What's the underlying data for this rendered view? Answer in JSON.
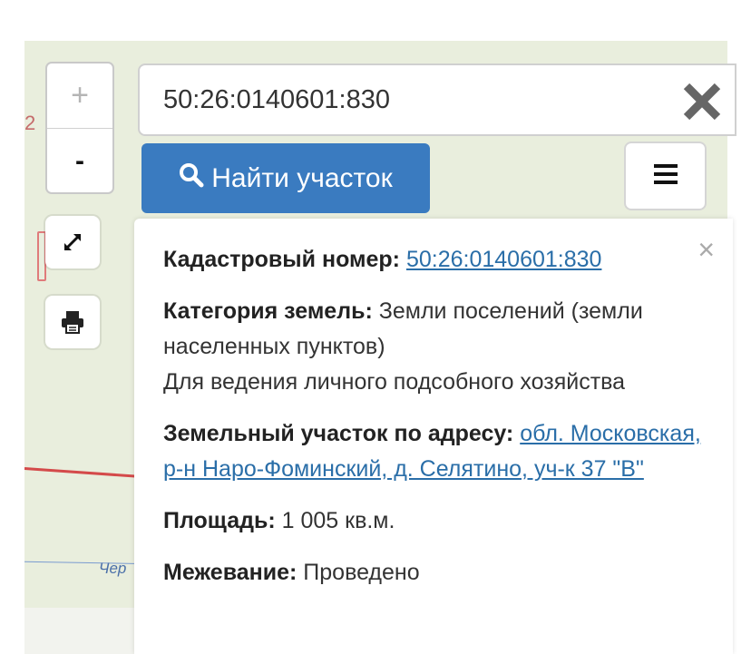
{
  "map": {
    "fragment_number": "2",
    "street_label": "Чер"
  },
  "zoom": {
    "in_label": "+",
    "out_label": "-"
  },
  "search": {
    "value": "50:26:0140601:830",
    "clear_icon": "close-icon"
  },
  "find_button": {
    "label": "Найти участок",
    "icon": "search-icon",
    "color": "#3a7bc0"
  },
  "panel": {
    "close_label": "×",
    "cadastral_label": "Кадастровый номер:",
    "cadastral_value": "50:26:0140601:830",
    "category_label": "Категория земель:",
    "category_value": "Земли поселений (земли населенных пунктов)",
    "usage_value": "Для ведения личного подсобного хозяйства",
    "address_label": "Земельный участок по адресу:",
    "address_value": "обл. Московская, р-н Наро-Фоминский, д. Селятино, уч-к 37 \"В\"",
    "area_label": "Площадь:",
    "area_value": "1 005 кв.м.",
    "survey_label": "Межевание:",
    "survey_value": "Проведено"
  },
  "colors": {
    "link": "#2a6ea8",
    "map_bg": "#e9eedd"
  }
}
